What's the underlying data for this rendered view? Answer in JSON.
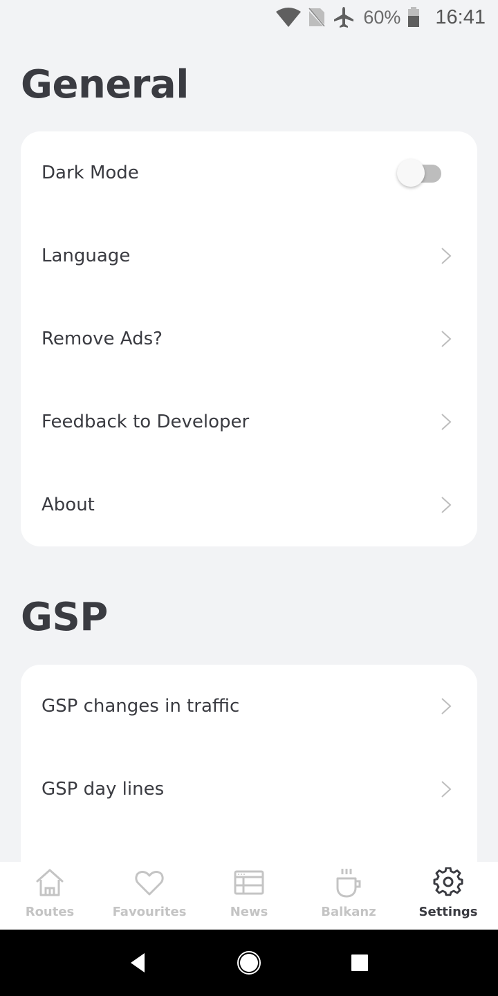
{
  "status_bar": {
    "icons": [
      "wifi-icon",
      "no-sim-icon",
      "airplane-mode-icon",
      "battery-icon"
    ],
    "battery_percent": "60%",
    "time": "16:41"
  },
  "sections": [
    {
      "title": "General",
      "items": [
        {
          "label": "Dark Mode",
          "type": "toggle",
          "value": false
        },
        {
          "label": "Language",
          "type": "link"
        },
        {
          "label": "Remove Ads?",
          "type": "link"
        },
        {
          "label": "Feedback to Developer",
          "type": "link"
        },
        {
          "label": "About",
          "type": "link"
        }
      ]
    },
    {
      "title": "GSP",
      "items": [
        {
          "label": "GSP changes in traffic",
          "type": "link"
        },
        {
          "label": "GSP day lines",
          "type": "link"
        }
      ]
    }
  ],
  "bottom_nav": {
    "items": [
      {
        "label": "Routes",
        "icon": "home-icon",
        "active": false
      },
      {
        "label": "Favourites",
        "icon": "heart-icon",
        "active": false
      },
      {
        "label": "News",
        "icon": "news-icon",
        "active": false
      },
      {
        "label": "Balkanz",
        "icon": "coffee-cup-icon",
        "active": false
      },
      {
        "label": "Settings",
        "icon": "gear-icon",
        "active": true
      }
    ]
  },
  "colors": {
    "background": "#f2f3f5",
    "card": "#ffffff",
    "text_primary": "#3a3b41",
    "nav_inactive": "#c4c4c4",
    "toggle_track_off": "#bdbdbd"
  },
  "system_nav": [
    "back-button",
    "home-button",
    "recents-button"
  ]
}
